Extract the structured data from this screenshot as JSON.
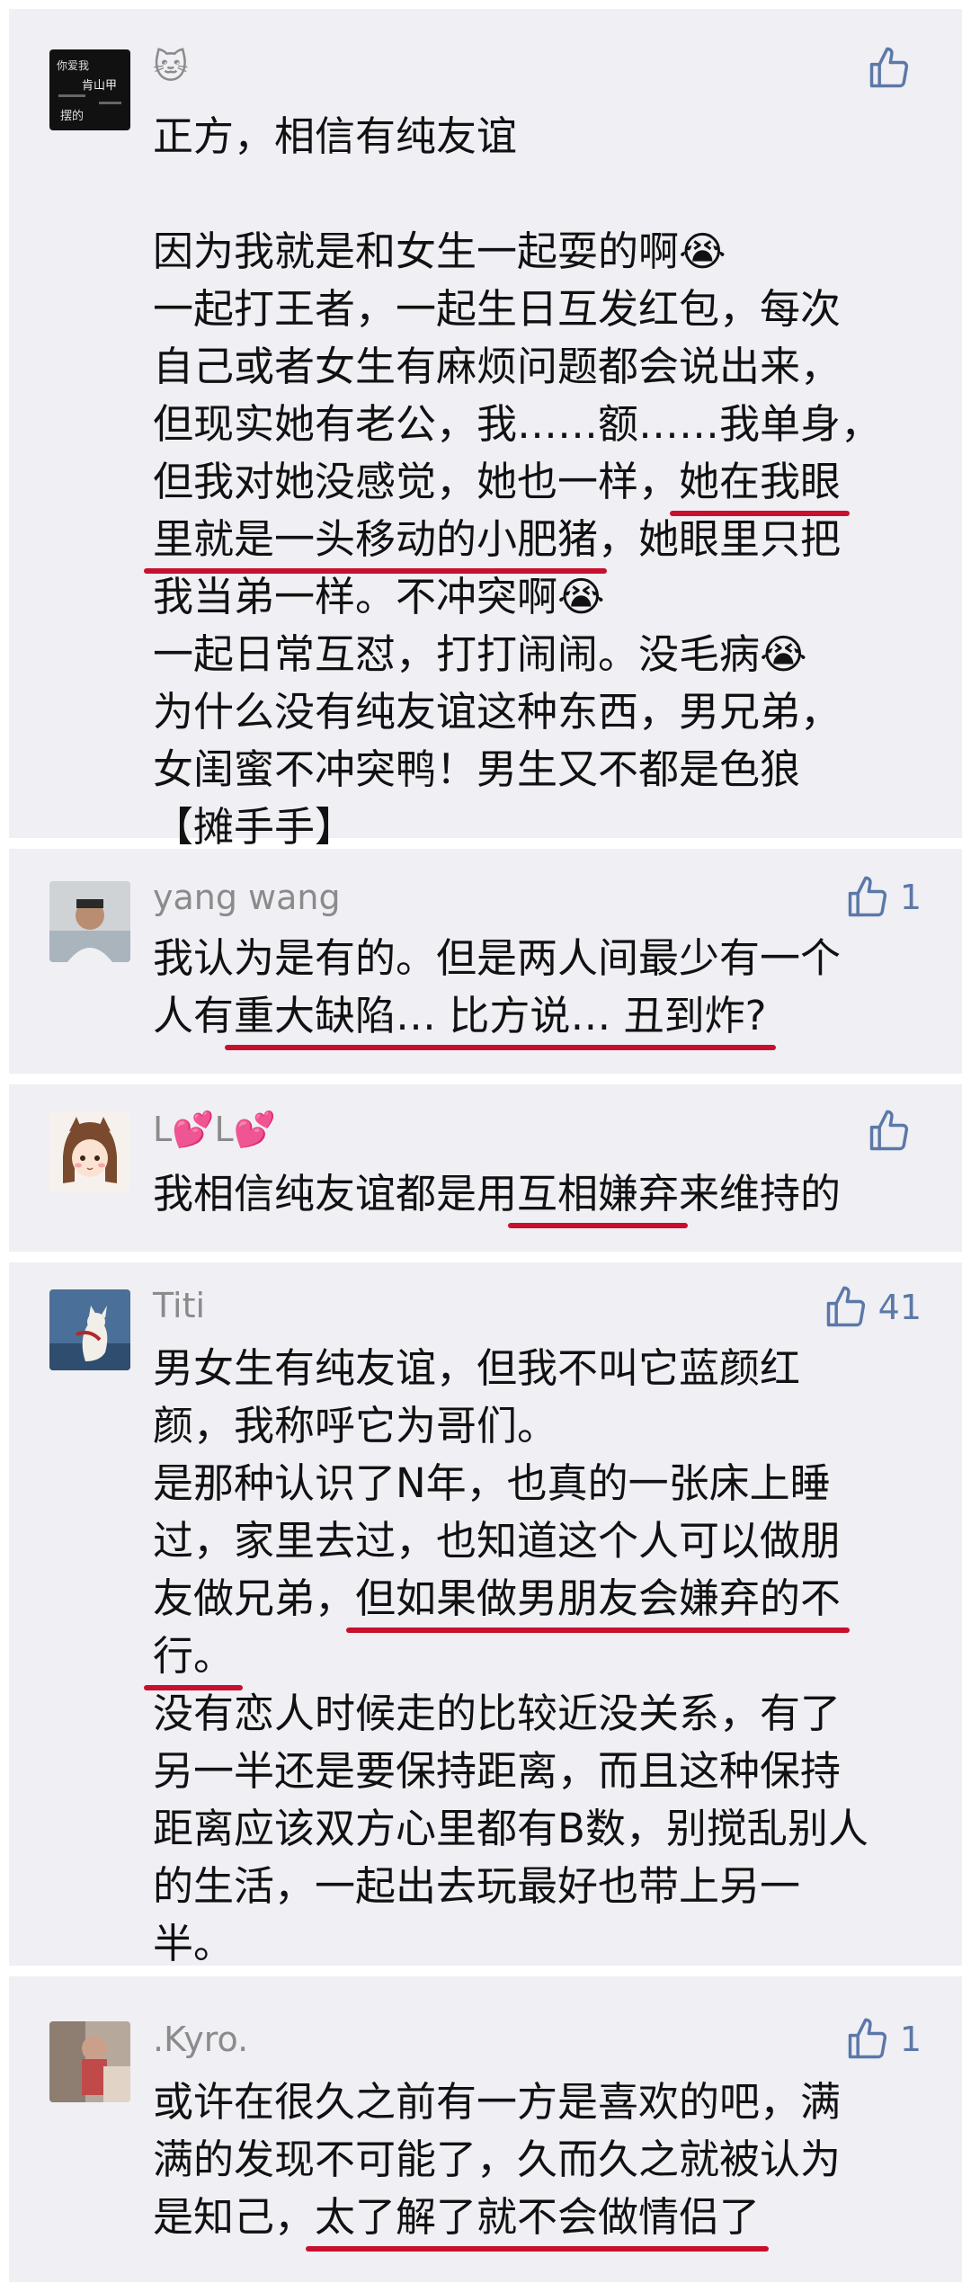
{
  "comments": [
    {
      "user": "🐱",
      "likes": "",
      "avatar_text": {
        "a": "你爱我",
        "b": "肯山甲",
        "c": "摆的"
      },
      "lines": [
        {
          "t": "正方，相信有纯友谊"
        },
        {
          "t": ""
        },
        {
          "t": "因为我就是和女生一起耍的啊😭"
        },
        {
          "t": "一起打王者，一起生日互发红包，每次"
        },
        {
          "t": "自己或者女生有麻烦问题都会说出来，"
        },
        {
          "t": "但现实她有老公，我……额……我单身，"
        },
        {
          "pre": "但我对她没感觉，她也一样，",
          "u": "她在我眼"
        },
        {
          "u": "里就是一头移动的小肥猪",
          "post": "，她眼里只把"
        },
        {
          "t": "我当弟一样。不冲突啊😭"
        },
        {
          "t": "一起日常互怼，打打闹闹。没毛病😭"
        },
        {
          "t": "为什么没有纯友谊这种东西，男兄弟，"
        },
        {
          "t": "女闺蜜不冲突鸭！男生又不都是色狼"
        },
        {
          "t": "【摊手手】"
        }
      ]
    },
    {
      "user": "yang wang",
      "likes": "1",
      "lines": [
        {
          "t": "我认为是有的。但是两人间最少有一个"
        },
        {
          "pre": "人有",
          "u": "重大缺陷… 比方说… 丑到炸?"
        }
      ]
    },
    {
      "user": "L💕L💕",
      "likes": "",
      "lines": [
        {
          "pre": "我相信纯友谊都是用",
          "u": "互相嫌弃",
          "post": "来维持的"
        }
      ]
    },
    {
      "user": "Titi",
      "likes": "41",
      "lines": [
        {
          "t": "男女生有纯友谊，但我不叫它蓝颜红"
        },
        {
          "t": "颜，我称呼它为哥们。"
        },
        {
          "t": "是那种认识了N年，也真的一张床上睡"
        },
        {
          "t": "过，家里去过，也知道这个人可以做朋"
        },
        {
          "pre": "友做兄弟，",
          "u": "但如果做男朋友会嫌弃的不"
        },
        {
          "u": "行。"
        },
        {
          "t": "没有恋人时候走的比较近没关系，有了"
        },
        {
          "t": "另一半还是要保持距离，而且这种保持"
        },
        {
          "t": "距离应该双方心里都有B数，别搅乱别人"
        },
        {
          "t": "的生活，一起出去玩最好也带上另一"
        },
        {
          "t": "半。"
        }
      ]
    },
    {
      "user": ".Kyro.",
      "likes": "1",
      "lines": [
        {
          "t": "或许在很久之前有一方是喜欢的吧，满"
        },
        {
          "t": "满的发现不可能了，久而久之就被认为"
        },
        {
          "pre": "是知己，",
          "u": "太了解了就不会做情侣了"
        }
      ]
    }
  ],
  "colors": {
    "card": "#efeff4",
    "username": "#8b8b8b",
    "like": "#5b78a8",
    "underline": "#c8102e"
  },
  "icons": {
    "like": "thumbs-up-icon"
  }
}
